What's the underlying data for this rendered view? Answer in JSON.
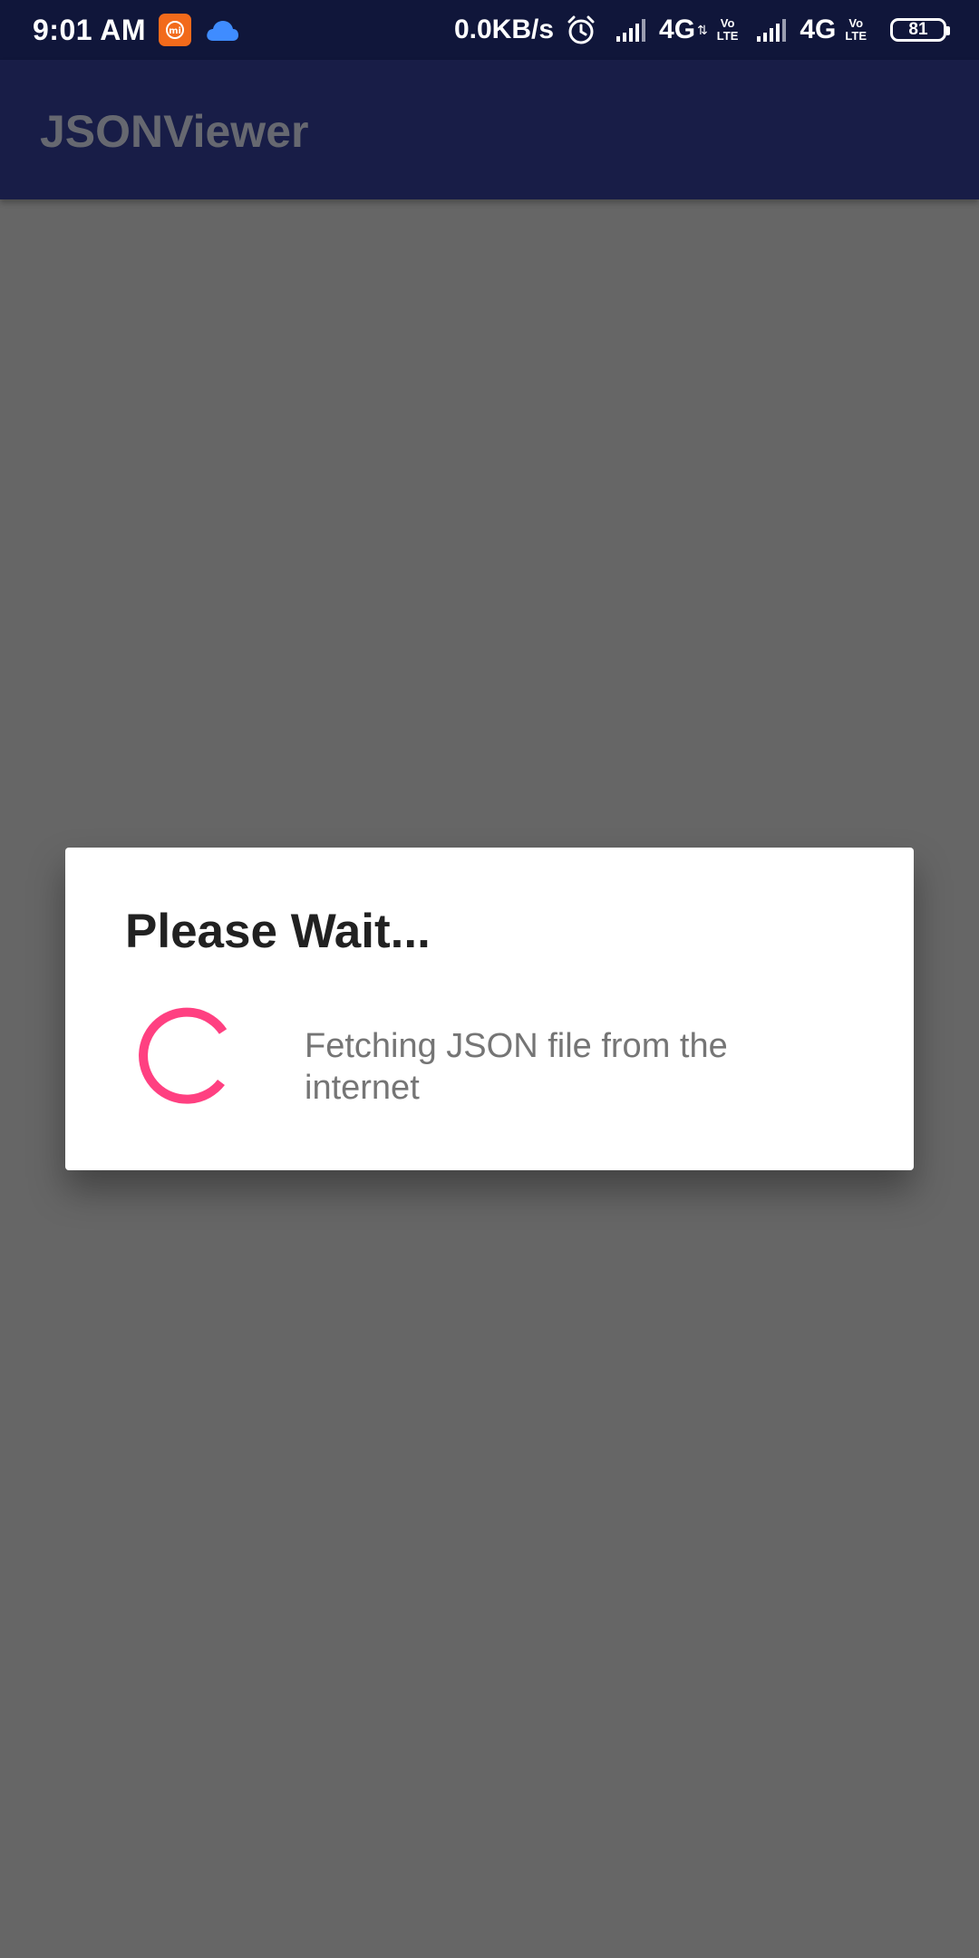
{
  "status_bar": {
    "time": "9:01 AM",
    "notification_icons": [
      "mi-app-icon",
      "cloud-icon"
    ],
    "net_speed": "0.0KB/s",
    "sim1": {
      "type": "4G",
      "volte_top": "Vo",
      "volte_bottom": "LTE"
    },
    "sim2": {
      "type": "4G",
      "volte_top": "Vo",
      "volte_bottom": "LTE"
    },
    "battery_level": "81",
    "colors": {
      "background": "#10163a",
      "cloud": "#3f8cff",
      "mi_badge": "#f26a1b"
    }
  },
  "app_bar": {
    "title": "JSONViewer",
    "background": "#181d47"
  },
  "dialog": {
    "title": "Please Wait...",
    "message": "Fetching JSON file from the internet",
    "spinner_color": "#ff4081",
    "scrim_color": "#666666"
  }
}
